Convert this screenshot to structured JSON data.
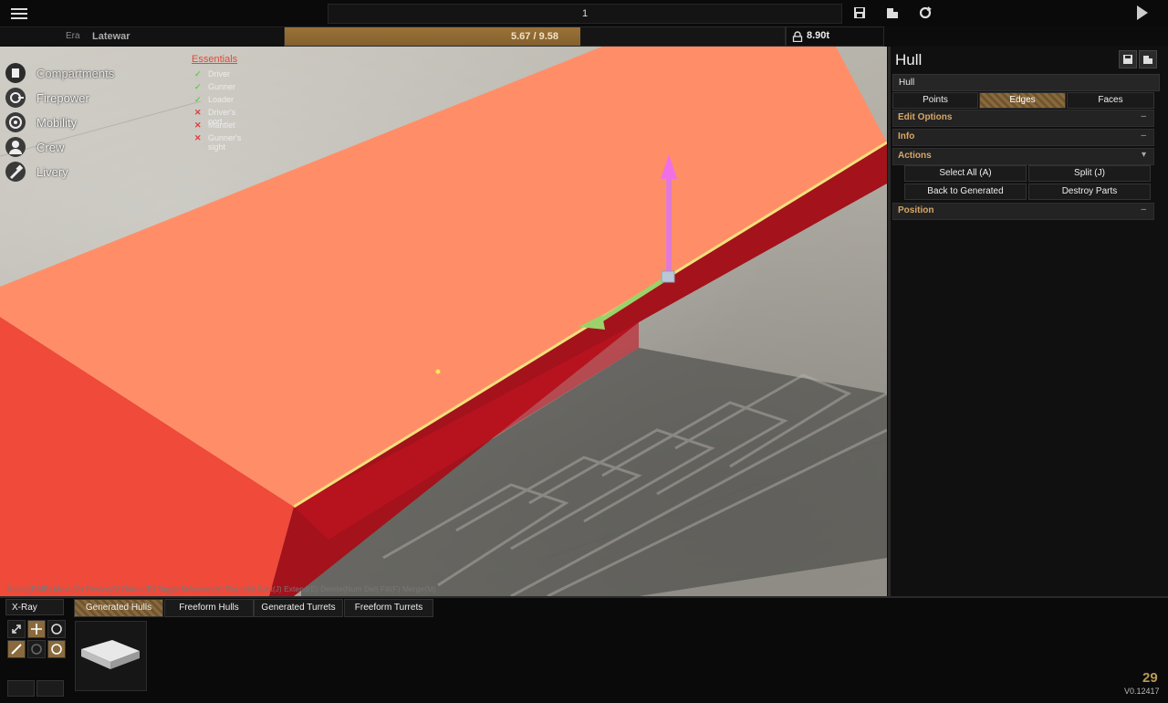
{
  "topbar": {
    "vehicle_name": "1"
  },
  "era": {
    "label": "Era",
    "value": "Latewar"
  },
  "cost": {
    "text": "5.67 / 9.58",
    "fraction": 0.592
  },
  "weight": {
    "text": "8.90t"
  },
  "categories": [
    {
      "label": "Compartments",
      "icon": "compartments-icon"
    },
    {
      "label": "Firepower",
      "icon": "firepower-icon"
    },
    {
      "label": "Mobility",
      "icon": "mobility-icon"
    },
    {
      "label": "Crew",
      "icon": "crew-icon"
    },
    {
      "label": "Livery",
      "icon": "livery-icon"
    }
  ],
  "essentials": {
    "title": "Essentials",
    "items": [
      {
        "label": "Driver",
        "ok": true
      },
      {
        "label": "Gunner",
        "ok": true
      },
      {
        "label": "Loader",
        "ok": true
      },
      {
        "label": "Driver's port",
        "ok": false
      },
      {
        "label": "Mantlet",
        "ok": false
      },
      {
        "label": "Gunner's sight",
        "ok": false
      }
    ]
  },
  "shortcuts": "Select(RMB) Move(G) Resize(S) Rotate(R) ToggleSelection(A) Slope(H) Split(J) Extend(E) Delete(Num Del) Fill(F) Merge(M)",
  "panel": {
    "title": "Hull",
    "field_value": "Hull",
    "modes": [
      "Points",
      "Edges",
      "Faces"
    ],
    "active_mode": "Edges",
    "sections": {
      "edit_options": {
        "label": "Edit Options",
        "toggle": "–"
      },
      "info": {
        "label": "Info",
        "toggle": "–"
      },
      "actions": {
        "label": "Actions",
        "toggle": "▾"
      },
      "position": {
        "label": "Position",
        "toggle": "–"
      }
    },
    "actions": {
      "select_all": "Select All (A)",
      "split": "Split (J)",
      "back_to_generated": "Back to Generated",
      "destroy_parts": "Destroy Parts"
    }
  },
  "bottom": {
    "xray": "X-Ray",
    "tabs": [
      "Generated Hulls",
      "Freeform Hulls",
      "Generated Turrets",
      "Freeform Turrets"
    ],
    "active_tab": "Generated Hulls"
  },
  "footer": {
    "frame_count": "29",
    "version": "V0.12417"
  },
  "colors": {
    "accent": "#8a6a3c",
    "hull_top": "#ff8f6a",
    "hull_side": "#a8111b",
    "essentials_title": "#e24a3a"
  }
}
